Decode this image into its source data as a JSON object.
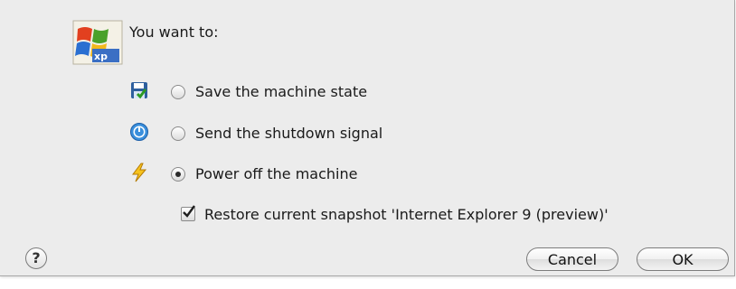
{
  "dialog": {
    "prompt": "You want to:",
    "logo_text": "xp"
  },
  "options": [
    {
      "label": "Save the machine state",
      "icon": "save-state-icon",
      "selected": false
    },
    {
      "label": "Send the shutdown signal",
      "icon": "power-button-icon",
      "selected": false
    },
    {
      "label": "Power off the machine",
      "icon": "lightning-bolt-icon",
      "selected": true
    }
  ],
  "restore_snapshot": {
    "label": "Restore current snapshot 'Internet Explorer 9 (preview)'",
    "checked": true
  },
  "buttons": {
    "help": "?",
    "cancel": "Cancel",
    "ok": "OK"
  }
}
